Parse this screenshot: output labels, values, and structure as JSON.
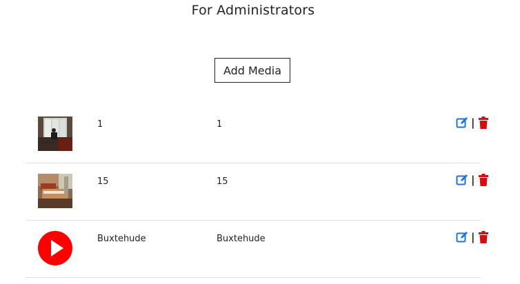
{
  "page": {
    "title": "For Administrators",
    "add_label": "Add Media"
  },
  "colors": {
    "edit": "#1a73e8",
    "delete": "#d10f0f",
    "play": "#ff0000"
  },
  "rows": [
    {
      "col_a": "1",
      "col_b": "1",
      "thumb": "photo-person-window-icon"
    },
    {
      "col_a": "15",
      "col_b": "15",
      "thumb": "photo-harpsichord-room-icon"
    },
    {
      "col_a": "Buxtehude",
      "col_b": "Buxtehude",
      "thumb": "play-icon"
    }
  ],
  "actions": {
    "separator": "|"
  }
}
